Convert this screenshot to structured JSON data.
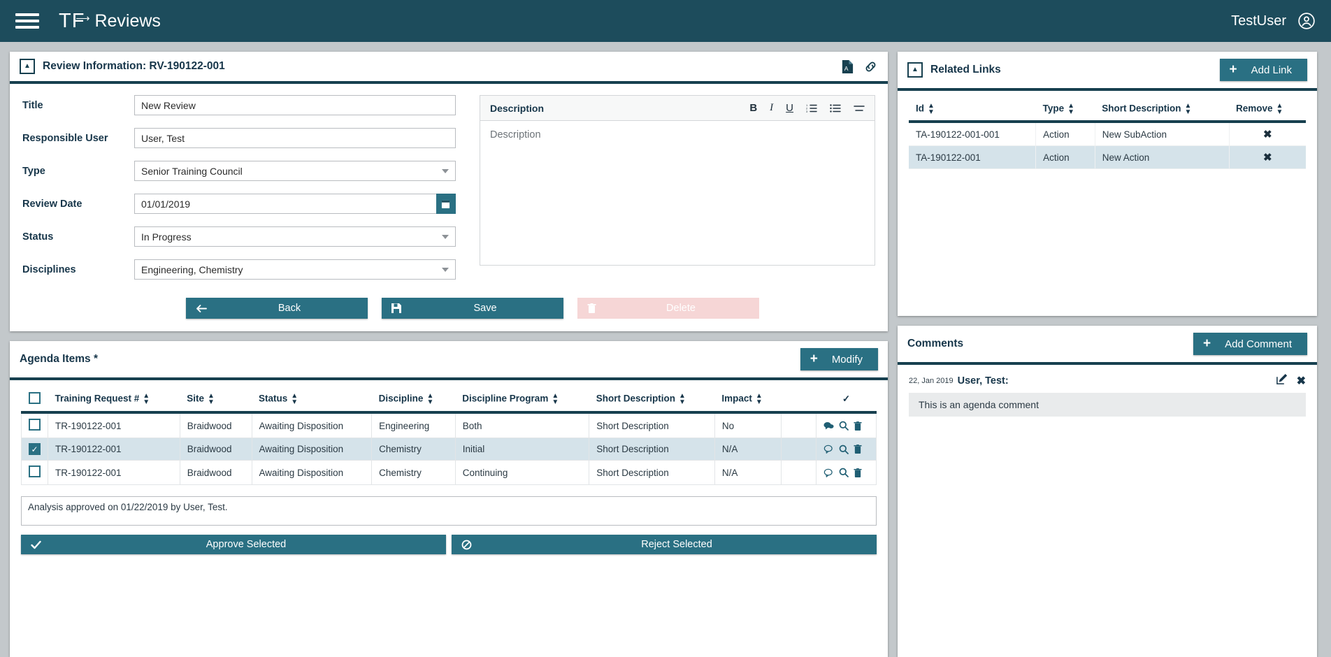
{
  "appbar": {
    "menu_icon": "hamburger-icon",
    "logo": "TF",
    "title": "Reviews",
    "username": "TestUser",
    "user_icon": "user-circle-icon"
  },
  "review_panel": {
    "title": "Review Information: RV-190122-001",
    "collapse_icon": "collapse-up-icon",
    "pdf_icon": "pdf-export-icon",
    "link_icon": "chain-link-icon",
    "fields": {
      "title_label": "Title",
      "title_value": "New Review",
      "responsible_label": "Responsible User",
      "responsible_value": "User, Test",
      "type_label": "Type",
      "type_value": "Senior Training Council",
      "date_label": "Review Date",
      "date_value": "01/01/2019",
      "status_label": "Status",
      "status_value": "In Progress",
      "disciplines_label": "Disciplines",
      "disciplines_value": "Engineering, Chemistry"
    },
    "description": {
      "header": "Description",
      "placeholder": "Description",
      "tools": [
        "B",
        "I",
        "U",
        "ordered-list-icon",
        "unordered-list-icon",
        "align-icon"
      ]
    },
    "buttons": {
      "back": "Back",
      "save": "Save",
      "delete": "Delete"
    }
  },
  "related_links": {
    "title": "Related Links",
    "add_label": "Add Link",
    "columns": [
      "Id",
      "Type",
      "Short Description",
      "Remove"
    ],
    "rows": [
      {
        "id": "TA-190122-001-001",
        "type": "Action",
        "short_description": "New SubAction",
        "remove": "✖",
        "selected": false
      },
      {
        "id": "TA-190122-001",
        "type": "Action",
        "short_description": "New Action",
        "remove": "✖",
        "selected": true
      }
    ]
  },
  "agenda": {
    "title": "Agenda Items *",
    "modify_label": "Modify",
    "columns": [
      "Training Request #",
      "Site",
      "Status",
      "Discipline",
      "Discipline Program",
      "Short Description",
      "Impact"
    ],
    "rows": [
      {
        "checked": false,
        "request": "TR-190122-001",
        "site": "Braidwood",
        "status": "Awaiting Disposition",
        "discipline": "Engineering",
        "program": "Both",
        "short_description": "Short Description",
        "impact": "No",
        "has_comments": true
      },
      {
        "checked": true,
        "request": "TR-190122-001",
        "site": "Braidwood",
        "status": "Awaiting Disposition",
        "discipline": "Chemistry",
        "program": "Initial",
        "short_description": "Short Description",
        "impact": "N/A",
        "has_comments": false
      },
      {
        "checked": false,
        "request": "TR-190122-001",
        "site": "Braidwood",
        "status": "Awaiting Disposition",
        "discipline": "Chemistry",
        "program": "Continuing",
        "short_description": "Short Description",
        "impact": "N/A",
        "has_comments": false
      }
    ],
    "approval_text": "Analysis approved on 01/22/2019 by User, Test.",
    "approve_label": "Approve Selected",
    "reject_label": "Reject Selected"
  },
  "comments": {
    "title": "Comments",
    "add_label": "Add Comment",
    "items": [
      {
        "date": "22, Jan 2019",
        "user": "User, Test:",
        "text": "This is an agenda comment"
      }
    ]
  },
  "colors": {
    "appbar": "#1d4c5c",
    "accent": "#2a7083",
    "panel_border": "#17404f",
    "selected_row": "#d5e3ea",
    "delete_disabled": "#f6d6d6",
    "page_bg": "#c3c8cb"
  }
}
